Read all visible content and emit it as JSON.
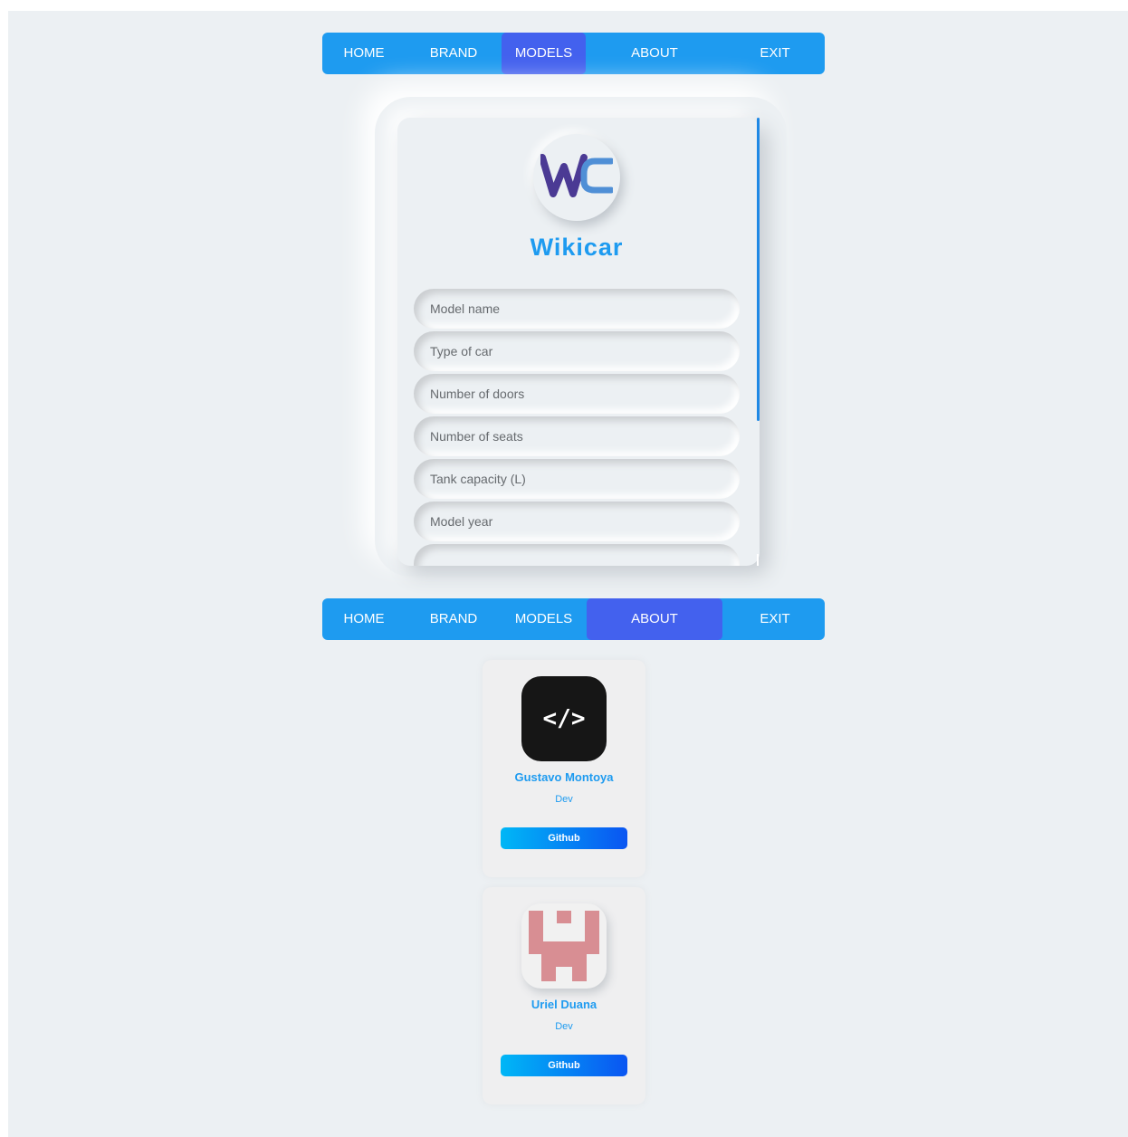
{
  "nav": {
    "home": "HOME",
    "brand": "BRAND",
    "models": "MODELS",
    "about": "ABOUT",
    "exit": "EXIT"
  },
  "form": {
    "logo_text": "WC",
    "brand_title": "Wikicar",
    "fields": [
      {
        "placeholder": "Model name",
        "value": ""
      },
      {
        "placeholder": "Type of car",
        "value": ""
      },
      {
        "placeholder": "Number of doors",
        "value": ""
      },
      {
        "placeholder": "Number of seats",
        "value": ""
      },
      {
        "placeholder": "Tank capacity (L)",
        "value": ""
      },
      {
        "placeholder": "Model year",
        "value": ""
      },
      {
        "placeholder": "",
        "value": ""
      }
    ]
  },
  "team": [
    {
      "name": "Gustavo Montoya",
      "role": "Dev",
      "avatar_icon": "code-icon",
      "avatar_text": "</>",
      "button": "Github"
    },
    {
      "name": "Uriel Duana",
      "role": "Dev",
      "avatar_icon": "pixel-identicon",
      "button": "Github"
    }
  ],
  "colors": {
    "nav_bg": "#1e9bf0",
    "nav_active": "#4361ee",
    "accent": "#1e9bf0",
    "page_bg": "#ecf0f3",
    "logo_purple": "#4b3a94",
    "logo_blue": "#4f8fd6",
    "identicon": "#d88e93"
  },
  "state": {
    "top_nav_active": "MODELS",
    "bottom_nav_active": "ABOUT"
  }
}
